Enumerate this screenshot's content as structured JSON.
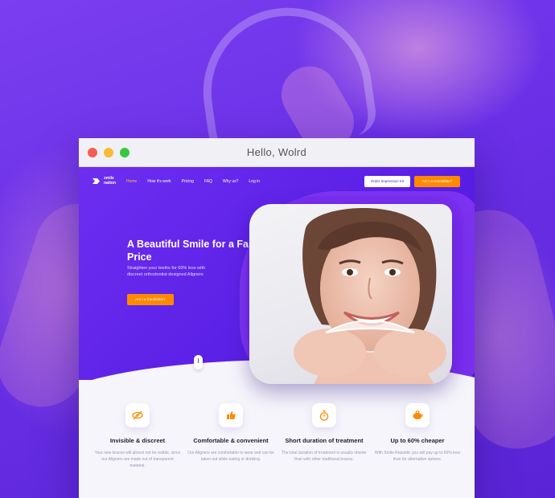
{
  "window": {
    "title": "Hello, Wolrd"
  },
  "brand": {
    "logo_text": "smile nation"
  },
  "nav": {
    "items": [
      {
        "label": "Home",
        "active": true
      },
      {
        "label": "How it's work",
        "active": false
      },
      {
        "label": "Pricing",
        "active": false
      },
      {
        "label": "FAQ",
        "active": false
      },
      {
        "label": "Why us?",
        "active": false
      },
      {
        "label": "Log in",
        "active": false
      }
    ],
    "order_button": "Order Impression Kit",
    "candidate_button": "Am I a Candidate?"
  },
  "hero": {
    "title": "A Beautiful Smile for a Fair Price",
    "subtitle": "Straighten your teeths for 60% less with discreet orthodontist-designed Aligners",
    "cta": "Am I a Candidate?"
  },
  "features": [
    {
      "icon": "eye-slash-icon",
      "title": "Invisible & discreet",
      "text": "Your new braces will almost not be visible, since our Aligners are made out of transparent material."
    },
    {
      "icon": "thumbs-up-icon",
      "title": "Comfortable & convenient",
      "text": "Our Aligners are comfortable to wear and can be taken out while eating or drinking."
    },
    {
      "icon": "stopwatch-icon",
      "title": "Short duration of treatment",
      "text": "The total duration of treatment is usually shorter than with other traditional braces."
    },
    {
      "icon": "piggy-bank-icon",
      "title": "Up to 60% cheaper",
      "text": "With Smile Republic you will pay up to 60% less than for alternative options."
    }
  ],
  "colors": {
    "brand_purple": "#6d2ef0",
    "accent_orange": "#ff8a00",
    "nav_active": "#ffb454"
  }
}
